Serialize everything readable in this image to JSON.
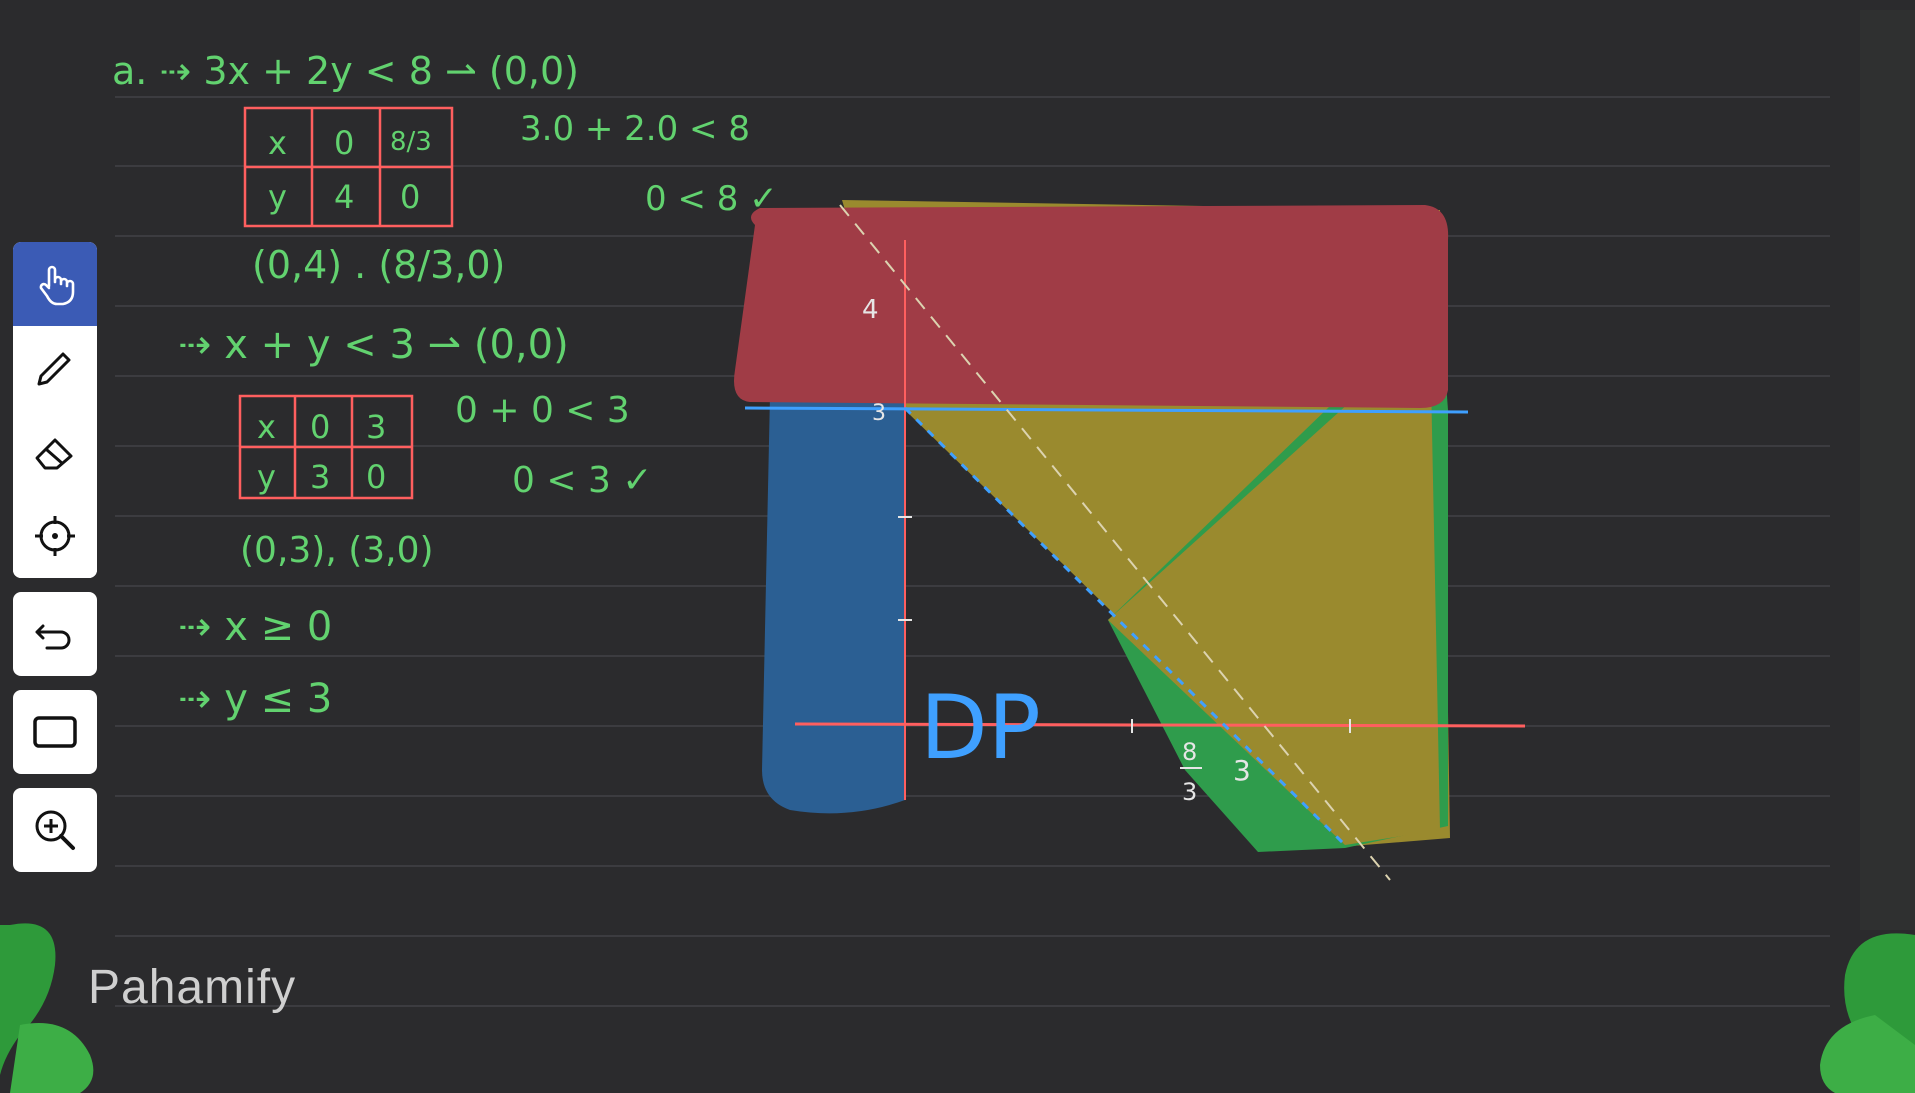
{
  "notes": {
    "line1": "a. ⇢  3x + 2y < 8 ⇀ (0,0)",
    "table1": {
      "x_label": "x",
      "y_label": "y",
      "x_vals": [
        "0",
        "8/3"
      ],
      "y_vals": [
        "4",
        "0"
      ]
    },
    "check1a": "3.0 + 2.0 < 8",
    "check1b": "0 < 8 ✓",
    "points1": "(0,4) . (8/3,0)",
    "line2": "⇢  x + y < 3 ⇀ (0,0)",
    "table2": {
      "x_label": "x",
      "y_label": "y",
      "x_vals": [
        "0",
        "3"
      ],
      "y_vals": [
        "3",
        "0"
      ]
    },
    "check2a": "0 + 0 < 3",
    "check2b": "0 < 3 ✓",
    "points2": "(0,3), (3,0)",
    "line3": "⇢  x ≥ 0",
    "line4": "⇢  y ≤ 3"
  },
  "graph": {
    "tick_4": "4",
    "tick_3": "3",
    "tick_8": "8",
    "tick_over3": "3",
    "tick_3x": "3",
    "region_label": "DP"
  },
  "colors": {
    "background": "#2b2b2d",
    "red_region": "#a03c46",
    "yellow_region": "#9a8a2e",
    "blue_region": "#2b5f93",
    "green_region": "#2f9c4c",
    "chalk_green": "#62d26f",
    "axis_red": "#ff5f5f",
    "line_blue": "#3fa0ff"
  },
  "toolbar": {
    "tools": [
      "hand-pointer-icon",
      "pen-icon",
      "eraser-icon",
      "laser-pointer-icon",
      "undo-icon",
      "rectangle-icon",
      "zoom-in-icon"
    ]
  },
  "brand": {
    "name": "Pahamify"
  }
}
